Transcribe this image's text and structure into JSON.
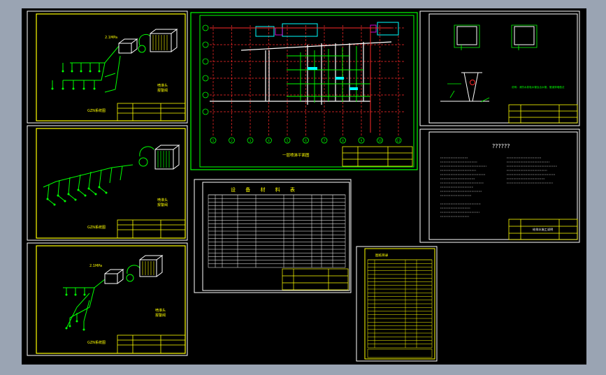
{
  "colors": {
    "viewport_bg": "#9aa4b3",
    "model_space": "#000000",
    "yellow": "#ffff00",
    "white": "#ffffff",
    "green": "#00ff00",
    "red": "#ff2a2a",
    "cyan": "#00ffff",
    "magenta": "#ff00ff"
  },
  "sheets": {
    "system_1": {
      "title": "GZN系统图",
      "legend_a": "喷淋头",
      "legend_b": "报警阀",
      "pressure": "2.1MPa"
    },
    "system_2": {
      "title": "GZN系统图",
      "legend_a": "喷淋头",
      "legend_b": "报警阀"
    },
    "system_3": {
      "title": "GZN系统图",
      "legend_a": "喷淋头",
      "legend_b": "报警阀",
      "pressure": "2.1MPa"
    },
    "plan": {
      "title": "一层喷淋平面图",
      "axis_top": [
        "1",
        "2",
        "3",
        "4",
        "5",
        "6",
        "7",
        "8",
        "9",
        "10",
        "11"
      ]
    },
    "materials": {
      "title": "设 备 材 料 表"
    },
    "details": {
      "note": "说明：消防水泵吸水管及出水管，管道穿墙做法"
    },
    "notes": {
      "title": "??????",
      "stamp": "给排水施工说明"
    },
    "catalog": {
      "title": "图纸目录"
    }
  }
}
